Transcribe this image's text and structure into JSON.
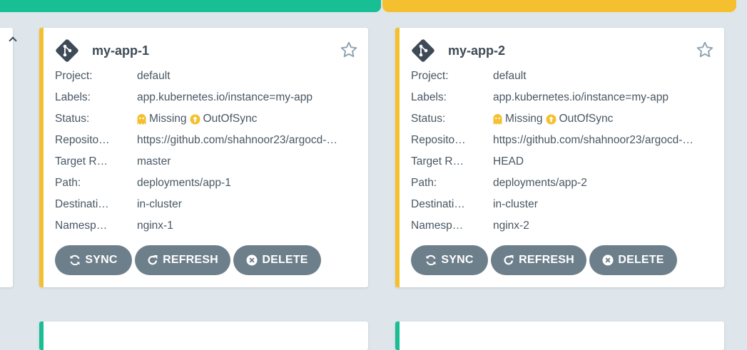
{
  "colors": {
    "synced_green": "#18be94",
    "outofsync_yellow": "#f4c030",
    "button_gray": "#6d7f8b",
    "background": "#dee6eb"
  },
  "cards": [
    {
      "name": "my-app-1",
      "fields": [
        {
          "key": "Project:",
          "value": "default"
        },
        {
          "key": "Labels:",
          "value": "app.kubernetes.io/instance=my-app"
        },
        {
          "key": "Status:",
          "health": "Missing",
          "sync": "OutOfSync"
        },
        {
          "key": "Reposito…",
          "value": "https://github.com/shahnoor23/argocd-…"
        },
        {
          "key": "Target R…",
          "value": "master"
        },
        {
          "key": "Path:",
          "value": "deployments/app-1"
        },
        {
          "key": "Destinati…",
          "value": "in-cluster"
        },
        {
          "key": "Namesp…",
          "value": "nginx-1"
        }
      ],
      "buttons": {
        "sync": "SYNC",
        "refresh": "REFRESH",
        "delete": "DELETE"
      }
    },
    {
      "name": "my-app-2",
      "fields": [
        {
          "key": "Project:",
          "value": "default"
        },
        {
          "key": "Labels:",
          "value": "app.kubernetes.io/instance=my-app"
        },
        {
          "key": "Status:",
          "health": "Missing",
          "sync": "OutOfSync"
        },
        {
          "key": "Reposito…",
          "value": "https://github.com/shahnoor23/argocd-…"
        },
        {
          "key": "Target R…",
          "value": "HEAD"
        },
        {
          "key": "Path:",
          "value": "deployments/app-2"
        },
        {
          "key": "Destinati…",
          "value": "in-cluster"
        },
        {
          "key": "Namesp…",
          "value": "nginx-2"
        }
      ],
      "buttons": {
        "sync": "SYNC",
        "refresh": "REFRESH",
        "delete": "DELETE"
      }
    }
  ]
}
